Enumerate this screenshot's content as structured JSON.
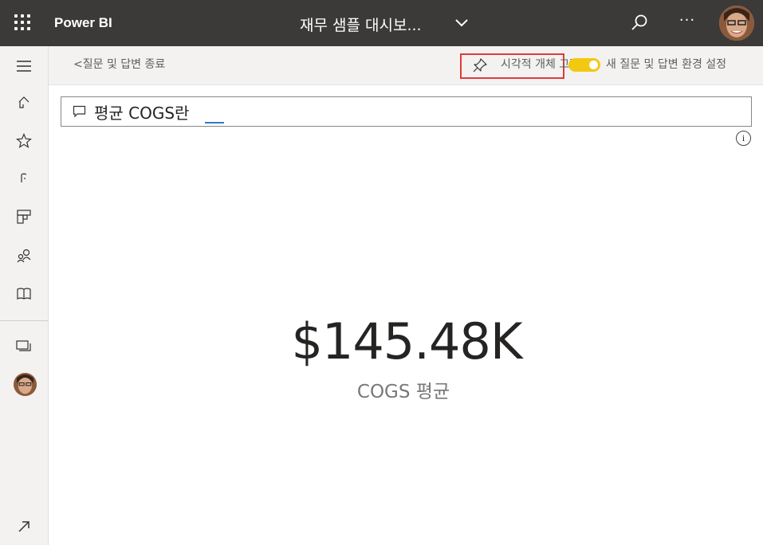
{
  "app": {
    "name": "Power BI",
    "dashboard_title": "재무 샘플 대시보..."
  },
  "subbar": {
    "exit_label": "<질문 및 답변 종료",
    "pin_label": "시각적 개체 고정",
    "new_qa_label": "새 질문 및 답변 환경 설정",
    "toggle_on": true,
    "accent_color": "#f2c811",
    "highlight_color": "#e03b3b"
  },
  "qa": {
    "query": "평균 COGS란"
  },
  "result": {
    "value": "$145.48K",
    "label": "COGS 평균"
  },
  "sidebar": {
    "items": [
      {
        "icon": "hamburger-icon"
      },
      {
        "icon": "home-icon"
      },
      {
        "icon": "star-icon"
      },
      {
        "icon": "recent-icon"
      },
      {
        "icon": "apps-icon"
      },
      {
        "icon": "shared-icon"
      },
      {
        "icon": "learn-icon"
      },
      {
        "icon": "workspaces-icon"
      },
      {
        "icon": "avatar"
      },
      {
        "icon": "expand-icon"
      }
    ]
  }
}
